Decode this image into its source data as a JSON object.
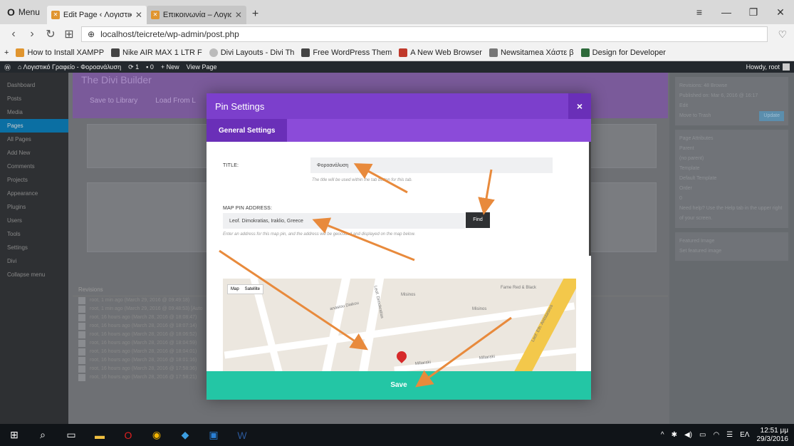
{
  "browser": {
    "menu_label": "Menu",
    "tabs": [
      {
        "label": "Edit Page ‹ Λογιστικό Γρα…",
        "active": true
      },
      {
        "label": "Επικοινωνία – Λογιστικό …",
        "active": false
      }
    ],
    "url": "localhost/teicrete/wp-admin/post.php",
    "bookmarks": [
      "How to Install XAMPP",
      "Nike AIR MAX 1 LTR F",
      "Divi Layouts - Divi Th",
      "Free WordPress Them",
      "A New Web Browser",
      "Newsitamea Χάστε β",
      "Design for Developer"
    ]
  },
  "wp_admin_bar": {
    "site": "Λογιστικό Γραφείο - Φοροανάλυση",
    "updates": "1",
    "comments": "0",
    "new_label": "+ New",
    "view_label": "View Page",
    "howdy": "Howdy, root"
  },
  "wp_sidebar": {
    "items": [
      "Dashboard",
      "Posts",
      "Media",
      "Pages",
      "All Pages",
      "Add New",
      "Comments",
      "Projects",
      "Appearance",
      "Plugins",
      "Users",
      "Tools",
      "Settings",
      "Divi",
      "Collapse menu"
    ]
  },
  "divi": {
    "title": "The Divi Builder",
    "save_library": "Save to Library",
    "load_from": "Load From L"
  },
  "revisions": {
    "heading": "Revisions",
    "lines": [
      "root, 1 min ago (March 29, 2016 @ 09:49:18)",
      "root, 1 min ago (March 29, 2016 @ 09:48:53) [Auto",
      "root, 16 hours ago (March 28, 2016 @ 18:08:47)",
      "root, 16 hours ago (March 28, 2016 @ 18:07:14)",
      "root, 16 hours ago (March 28, 2016 @ 18:06:52)",
      "root, 16 hours ago (March 28, 2016 @ 18:04:59)",
      "root, 16 hours ago (March 28, 2016 @ 18:04:01)",
      "root, 16 hours ago (March 28, 2016 @ 18:01:16)",
      "root, 16 hours ago (March 28, 2016 @ 17:58:36)",
      "root, 16 hours ago (March 28, 2016 @ 17:58:21)"
    ]
  },
  "wp_right": {
    "revisions": "Revisions: 48 Browse",
    "published": "Published on: Mar 6, 2016 @ 16:17",
    "edit": "Edit",
    "move_trash": "Move to Trash",
    "update": "Update",
    "page_attributes": "Page Attributes",
    "parent": "Parent",
    "parent_value": "(no parent)",
    "template": "Template",
    "template_value": "Default Template",
    "order": "Order",
    "order_value": "0",
    "help": "Need help? Use the Help tab in the upper right of your screen.",
    "featured_image": "Featured Image",
    "set_featured": "Set featured image"
  },
  "modal": {
    "title": "Pin Settings",
    "close": "×",
    "tab": "General Settings",
    "title_label": "TITLE:",
    "title_value": "Φοροανάλυση",
    "title_hint": "The title will be used within the tab button for this tab.",
    "address_label": "MAP PIN ADDRESS:",
    "address_value": "Leof. Dimokratias, Iraklio, Greece",
    "find_label": "Find",
    "address_hint": "Enter an address for this map pin, and the address will be geocoded and displayed on the map below.",
    "map_tab_map": "Map",
    "map_tab_satellite": "Satellite",
    "streets": [
      "Misinos",
      "anasiou Diakou",
      "Leof. Dimokratias",
      "Misinos",
      "Miliaraki",
      "Miliaraki",
      "Fame Red & Black",
      "Leof. Eth. Antistaseos"
    ],
    "save_label": "Save"
  },
  "taskbar": {
    "time": "12:51 μμ",
    "date": "29/3/2016",
    "lang": "ΕΛ"
  },
  "colors": {
    "modal_purple": "#7c3fcc",
    "save_green": "#23c6a5",
    "arrow_orange": "#e88a3c"
  }
}
